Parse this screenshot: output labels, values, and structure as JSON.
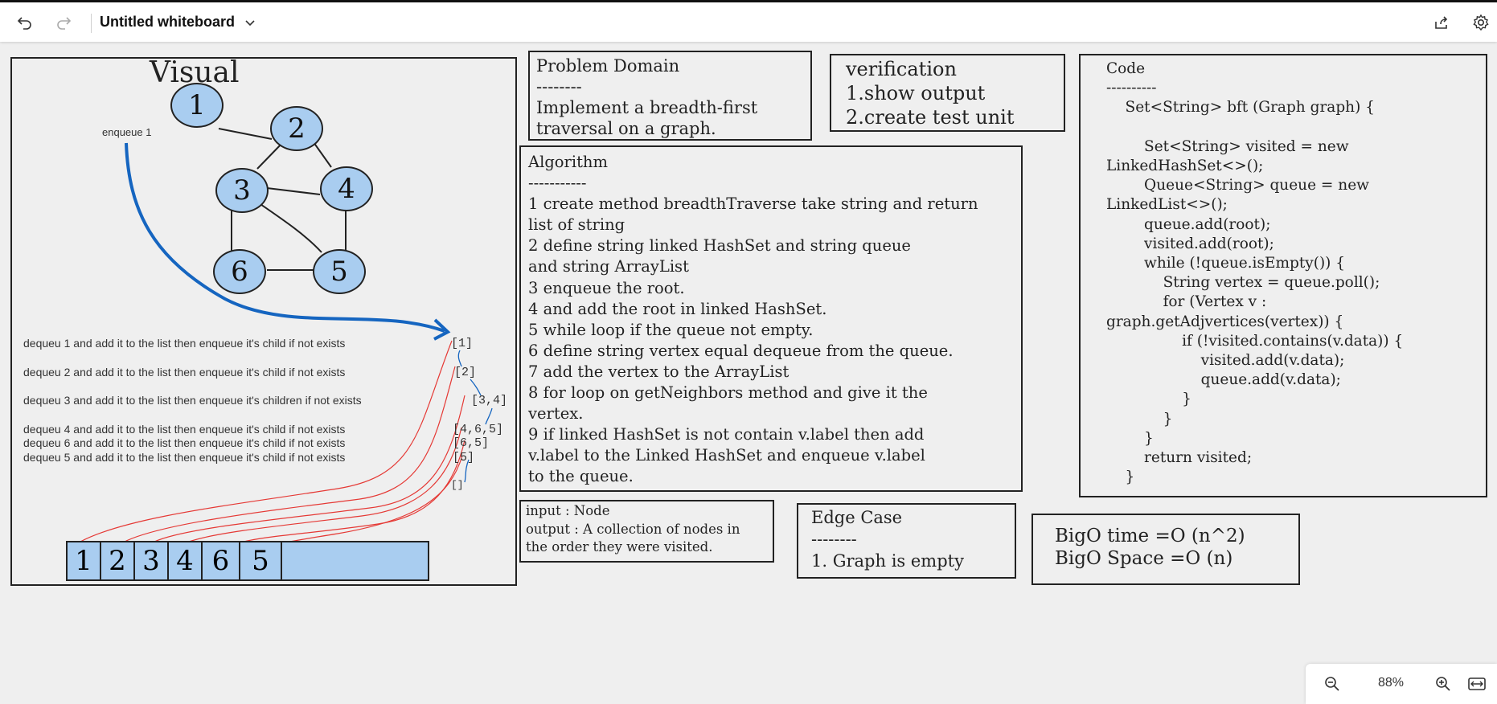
{
  "topbar": {
    "title": "Untitled whiteboard",
    "icons": [
      "undo-icon",
      "redo-icon",
      "chevron-down-icon",
      "share-icon",
      "settings-icon"
    ]
  },
  "visual": {
    "title": "Visual",
    "enqueue_label": "enqueue 1",
    "nodes": [
      "1",
      "2",
      "3",
      "4",
      "6",
      "5"
    ],
    "steps": [
      {
        "text": "dequeu 1 and add it to the list then enqueue it's child if not exists",
        "queue": "[1]"
      },
      {
        "text": "dequeu 2 and add it to the list then enqueue it's child if not exists",
        "queue": "[2]"
      },
      {
        "text": "dequeu 3 and add it to the list then enqueue it's children if not exists",
        "queue": "[3,4]"
      },
      {
        "text": "dequeu 4 and add it to the list then enqueue it's child if not exists",
        "queue": "[4,6,5]"
      },
      {
        "text": "dequeu 6 and add it to the list then enqueue it's child if not exists",
        "queue": "[6,5]"
      },
      {
        "text": "dequeu 5 and add it to the list then enqueue it's child if not exists",
        "queue": "[5]"
      }
    ],
    "empty_queue": "[]",
    "result": [
      "1",
      "2",
      "3",
      "4",
      "6",
      "5"
    ]
  },
  "problem": {
    "lines": [
      "Problem Domain",
      "--------",
      "Implement a breadth-first",
      "traversal on a graph."
    ]
  },
  "verification": {
    "lines": [
      "verification",
      "1.show output",
      "2.create test unit"
    ]
  },
  "algorithm": {
    "lines": [
      "Algorithm",
      "-----------",
      "1 create method breadthTraverse take string and return",
      "list of string",
      "2 define string linked HashSet and string queue",
      "and string ArrayList",
      "3 enqueue the root.",
      "4 and add the root in linked HashSet.",
      "5 while loop if the queue not empty.",
      "6 define string vertex equal dequeue from the queue.",
      "7 add the vertex to the ArrayList",
      "8 for loop on getNeighbors method and give it the",
      "vertex.",
      "9 if linked HashSet is not contain v.label then add",
      "v.label to the Linked HashSet and enqueue v.label",
      "to the queue."
    ]
  },
  "code": {
    "lines": [
      "Code",
      "----------",
      "    Set<String> bft (Graph graph) {",
      "",
      "        Set<String> visited = new",
      "LinkedHashSet<>();",
      "        Queue<String> queue = new",
      "LinkedList<>();",
      "        queue.add(root);",
      "        visited.add(root);",
      "        while (!queue.isEmpty()) {",
      "            String vertex = queue.poll();",
      "            for (Vertex v :",
      "graph.getAdjvertices(vertex)) {",
      "                if (!visited.contains(v.data)) {",
      "                    visited.add(v.data);",
      "                    queue.add(v.data);",
      "                }",
      "            }",
      "        }",
      "        return visited;",
      "    }"
    ]
  },
  "io": {
    "lines": [
      "input : Node",
      "output : A collection of nodes in",
      "the order they were visited."
    ]
  },
  "edge": {
    "lines": [
      "Edge Case",
      "--------",
      "1. Graph is empty"
    ]
  },
  "bigo": {
    "lines": [
      "BigO time =O (n^2)",
      "BigO Space =O (n)"
    ]
  },
  "zoom": {
    "value": "88%"
  },
  "colors": {
    "node_fill": "#a9cdf0",
    "arrow_blue": "#1565c0",
    "arrow_red": "#e53935"
  }
}
